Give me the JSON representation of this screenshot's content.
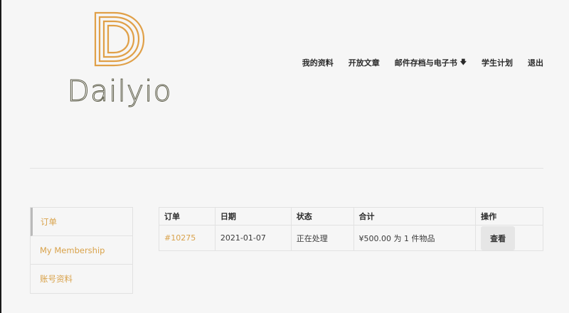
{
  "brand": {
    "logo_letter": "D",
    "name": "Dailyio",
    "accent_color": "#e0a048",
    "link_color": "#d9a24a"
  },
  "nav": {
    "items": [
      {
        "label": "我的资料"
      },
      {
        "label": "开放文章"
      },
      {
        "label": "邮件存档与电子书",
        "has_dropdown": true,
        "icon": "chevron-down-icon"
      },
      {
        "label": "学生计划"
      },
      {
        "label": "退出"
      }
    ]
  },
  "account_menu": {
    "items": [
      {
        "label": "订单",
        "active": true
      },
      {
        "label": "My Membership"
      },
      {
        "label": "账号资料"
      }
    ]
  },
  "orders": {
    "columns": [
      "订单",
      "日期",
      "状态",
      "合计",
      "操作"
    ],
    "rows": [
      {
        "number": "#10275",
        "date": "2021-01-07",
        "status": "正在处理",
        "total": "¥500.00 为 1 件物品",
        "action_label": "查看"
      }
    ]
  }
}
